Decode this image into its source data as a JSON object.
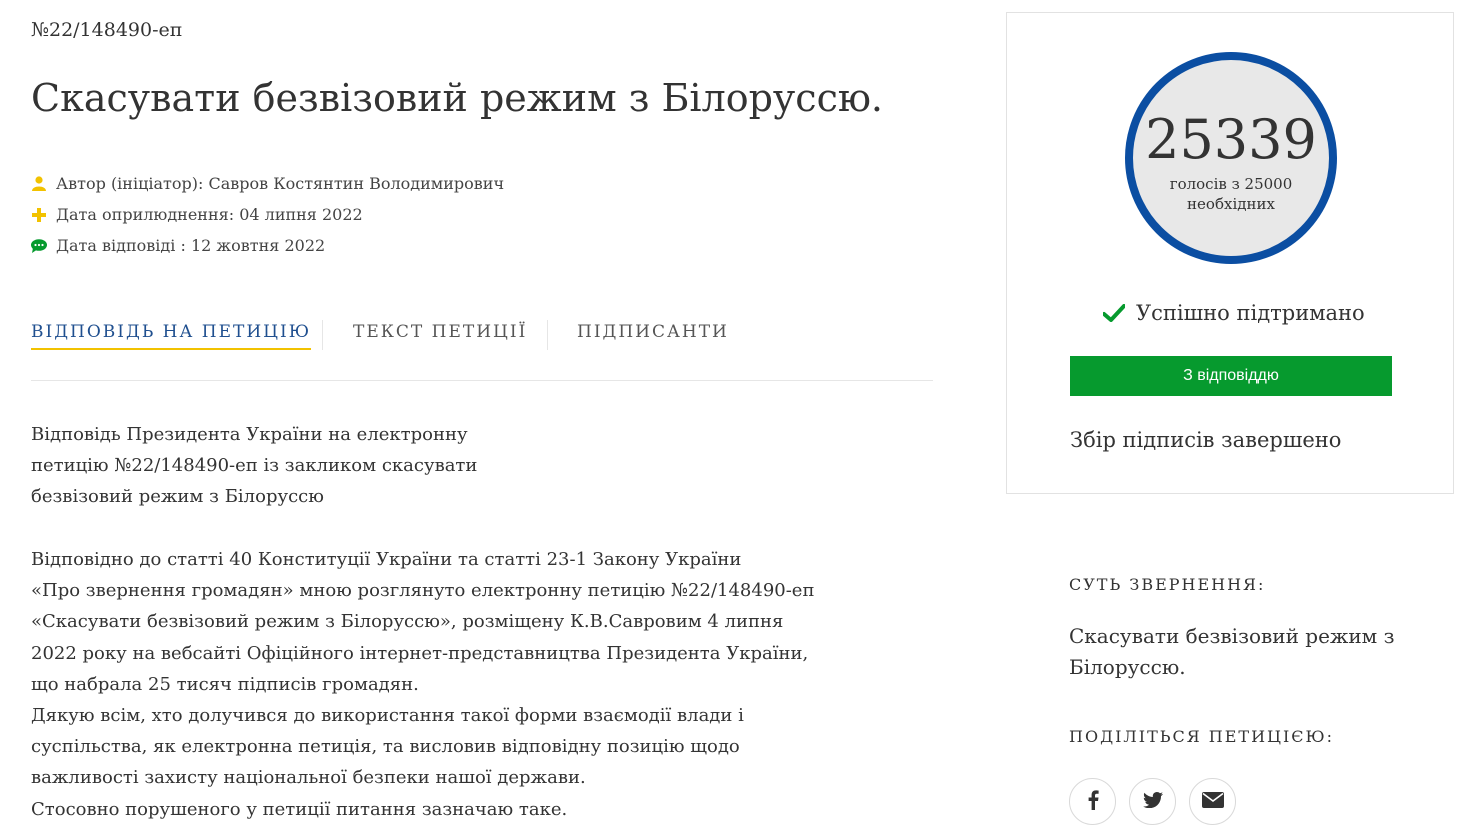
{
  "petition": {
    "number": "№22/148490-еп",
    "title": "Скасувати безвізовий режим з Білоруссю."
  },
  "meta": {
    "author": "Автор (ініціатор): Савров Костянтин Володимирович",
    "published": "Дата оприлюднення: 04 липня 2022",
    "answered": "Дата відповіді : 12 жовтня 2022"
  },
  "tabs": [
    {
      "label": "ВІДПОВІДЬ НА ПЕТИЦІЮ",
      "active": true
    },
    {
      "label": "ТЕКСТ ПЕТИЦІЇ",
      "active": false
    },
    {
      "label": "ПІДПИСАНТИ",
      "active": false
    }
  ],
  "answer": {
    "heading_lines": [
      "Відповідь Президента України на електронну",
      "петицію №22/148490-еп із закликом скасувати",
      "безвізовий режим з Білоруссю"
    ],
    "body_lines": [
      "Відповідно до статті 40 Конституції України та статті 23-1 Закону України",
      "«Про звернення громадян» мною розглянуто електронну петицію №22/148490-еп",
      "«Скасувати безвізовий режим з Білоруссю», розміщену К.В.Савровим 4 липня",
      "2022 року на вебсайті Офіційного інтернет-представництва Президента України,",
      "що набрала 25 тисяч підписів громадян.",
      "Дякую всім, хто долучився до використання такої форми взаємодії влади і",
      "суспільства, як електронна петиція, та висловив відповідну позицію щодо",
      "важливості захисту національної безпеки нашої держави.",
      "Стосовно порушеного у петиції питання зазначаю таке."
    ]
  },
  "card": {
    "count": "25339",
    "count_caption": "голосів з 25000\nнеобхідних",
    "status": "Успішно підтримано",
    "answer_button": "З відповіддю",
    "collection_status": "Збір підписів завершено"
  },
  "sidebar": {
    "summary_label": "СУТЬ ЗВЕРНЕННЯ:",
    "summary_text": "Скасувати безвізовий режим з Білоруссю.",
    "share_label": "ПОДІЛІТЬСЯ ПЕТИЦІЄЮ:",
    "share_icons": [
      "facebook-icon",
      "twitter-icon",
      "email-icon"
    ]
  },
  "colors": {
    "accent_yellow": "#f2c200",
    "brand_blue": "#0b4ea2",
    "success_green": "#069a2e",
    "active_tab_text": "#1f4f8f"
  }
}
